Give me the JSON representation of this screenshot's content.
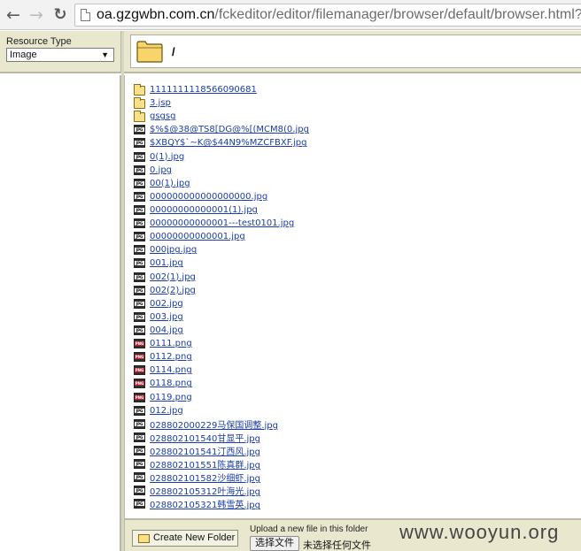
{
  "browser": {
    "url_host": "oa.gzgwbn.com.cn",
    "url_path": "/fckeditor/editor/filemanager/browser/default/browser.html?"
  },
  "resource_type": {
    "label": "Resource Type",
    "selected": "Image"
  },
  "current_path": "/",
  "files": [
    {
      "name": "1111111118566090681",
      "type": "folder"
    },
    {
      "name": "3.jsp",
      "type": "folder"
    },
    {
      "name": "gsgsg",
      "type": "folder"
    },
    {
      "name": "$%$@38@TS8[DG@%[(MCM8(0.jpg",
      "type": "jpg"
    },
    {
      "name": "$XBQY$`~K@$44N9%MZCFBXF.jpg",
      "type": "jpg"
    },
    {
      "name": "0(1).jpg",
      "type": "jpg"
    },
    {
      "name": "0.jpg",
      "type": "jpg"
    },
    {
      "name": "00(1).jpg",
      "type": "jpg"
    },
    {
      "name": "000000000000000000.jpg",
      "type": "jpg"
    },
    {
      "name": "00000000000001(1).jpg",
      "type": "jpg"
    },
    {
      "name": "00000000000001---test0101.jpg",
      "type": "jpg"
    },
    {
      "name": "00000000000001.jpg",
      "type": "jpg"
    },
    {
      "name": "000jpg.jpg",
      "type": "jpg"
    },
    {
      "name": "001.jpg",
      "type": "jpg"
    },
    {
      "name": "002(1).jpg",
      "type": "jpg"
    },
    {
      "name": "002(2).jpg",
      "type": "jpg"
    },
    {
      "name": "002.jpg",
      "type": "jpg"
    },
    {
      "name": "003.jpg",
      "type": "jpg"
    },
    {
      "name": "004.jpg",
      "type": "jpg"
    },
    {
      "name": "0111.png",
      "type": "png"
    },
    {
      "name": "0112.png",
      "type": "png"
    },
    {
      "name": "0114.png",
      "type": "png"
    },
    {
      "name": "0118.png",
      "type": "png"
    },
    {
      "name": "0119.png",
      "type": "png"
    },
    {
      "name": "012.jpg",
      "type": "jpg"
    },
    {
      "name": "028802000229马保国调整.jpg",
      "type": "jpg"
    },
    {
      "name": "028802101540甘显平.jpg",
      "type": "jpg"
    },
    {
      "name": "028802101541汀西风.jpg",
      "type": "jpg"
    },
    {
      "name": "028802101551陈真群.jpg",
      "type": "jpg"
    },
    {
      "name": "028802101582沙细虾.jpg",
      "type": "jpg"
    },
    {
      "name": "028802105312叶海光.jpg",
      "type": "jpg"
    },
    {
      "name": "028802105321韩雪英.jpg",
      "type": "jpg"
    }
  ],
  "bottom": {
    "create_folder_label": "Create New Folder",
    "upload_label": "Upload a new file in this folder",
    "choose_file_label": "选择文件",
    "no_file_label": "未选择任何文件",
    "watermark": "www.wooyun.org"
  }
}
